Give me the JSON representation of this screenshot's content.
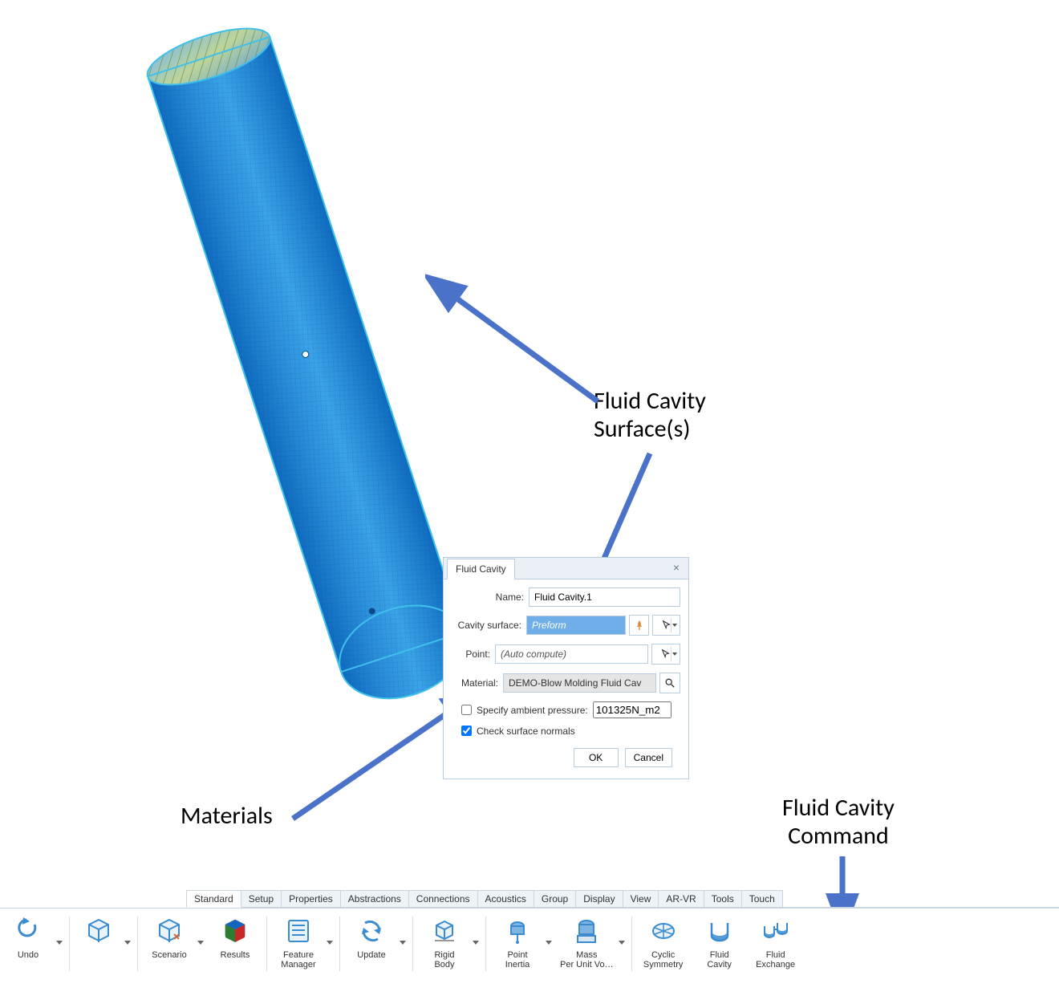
{
  "annotations": {
    "surface": "Fluid Cavity\nSurface(s)",
    "materials": "Materials",
    "command": "Fluid Cavity\nCommand"
  },
  "dialog": {
    "title": "Fluid Cavity",
    "labels": {
      "name": "Name:",
      "cavity_surface": "Cavity surface:",
      "point": "Point:",
      "material": "Material:",
      "specify_ambient_pressure": "Specify ambient pressure:",
      "check_surface_normals": "Check surface normals"
    },
    "values": {
      "name": "Fluid Cavity.1",
      "cavity_surface": "Preform",
      "point": "(Auto compute)",
      "material": "DEMO-Blow Molding Fluid Cav",
      "ambient_pressure": "101325N_m2",
      "specify_ambient_pressure_checked": false,
      "check_surface_normals_checked": true
    },
    "buttons": {
      "ok": "OK",
      "cancel": "Cancel"
    }
  },
  "ribbon": {
    "tabs": [
      "Standard",
      "Setup",
      "Properties",
      "Abstractions",
      "Connections",
      "Acoustics",
      "Group",
      "Display",
      "View",
      "AR-VR",
      "Tools",
      "Touch"
    ],
    "active_tab_index": 0,
    "tools": {
      "undo": "Undo",
      "scenario": "Scenario",
      "results": "Results",
      "feature_manager": "Feature\nManager",
      "update": "Update",
      "rigid_body": "Rigid\nBody",
      "point_inertia": "Point\nInertia",
      "mass_per_unit": "Mass\nPer Unit Vo…",
      "cyclic_symmetry": "Cyclic\nSymmetry",
      "fluid_cavity": "Fluid\nCavity",
      "fluid_exchange": "Fluid\nExchange"
    }
  }
}
